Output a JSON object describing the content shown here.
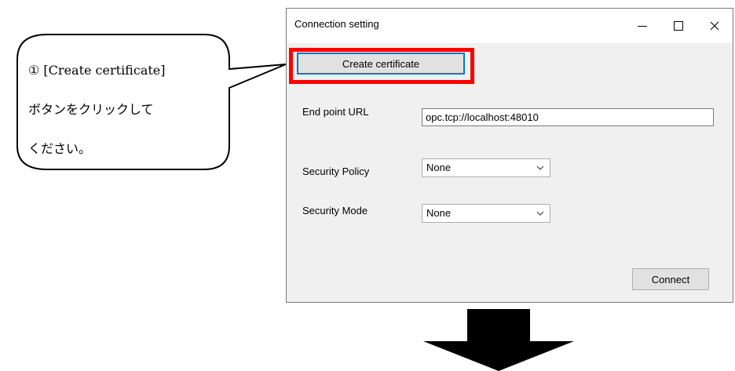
{
  "callout": {
    "lines": [
      "① [Create certificate]",
      "ボタンをクリックして",
      "ください。"
    ]
  },
  "window": {
    "title": "Connection setting",
    "minimize_icon": "minimize-icon",
    "maximize_icon": "maximize-icon",
    "close_icon": "close-icon",
    "close_glyph": "✕"
  },
  "form": {
    "create_certificate_label": "Create certificate",
    "endpoint_label": "End point URL",
    "endpoint_value": "opc.tcp://localhost:48010",
    "security_policy_label": "Security Policy",
    "security_policy_value": "None",
    "security_mode_label": "Security Mode",
    "security_mode_value": "None",
    "connect_label": "Connect"
  },
  "colors": {
    "highlight": "#ff0000",
    "focus": "#0078d7"
  }
}
